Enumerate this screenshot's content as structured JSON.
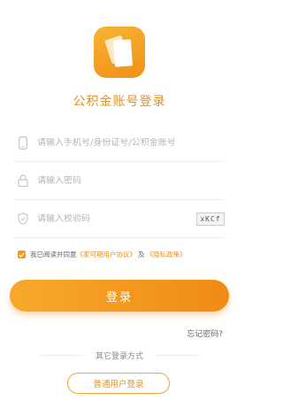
{
  "app": {
    "title": "公积金账号登录"
  },
  "form": {
    "account_placeholder": "请输入手机号/身份证号/公积金账号",
    "password_placeholder": "请输入密码",
    "captcha_placeholder": "请输入校验码",
    "captcha_text": "xKCf"
  },
  "agreement": {
    "prefix": "我已阅读并同意",
    "user_agreement": "《家可期用户协议》",
    "and": "及",
    "privacy_policy": "《隐私政策》",
    "checked": true
  },
  "buttons": {
    "login": "登录",
    "forgot_password": "忘记密码?",
    "other_methods": "其它登录方式",
    "normal_user_login": "普通用户登录"
  },
  "colors": {
    "accent": "#f29a1c",
    "accent_text": "#e8901c"
  },
  "icons": [
    "app-logo-icon",
    "phone-icon",
    "lock-icon",
    "shield-icon",
    "check-icon"
  ]
}
